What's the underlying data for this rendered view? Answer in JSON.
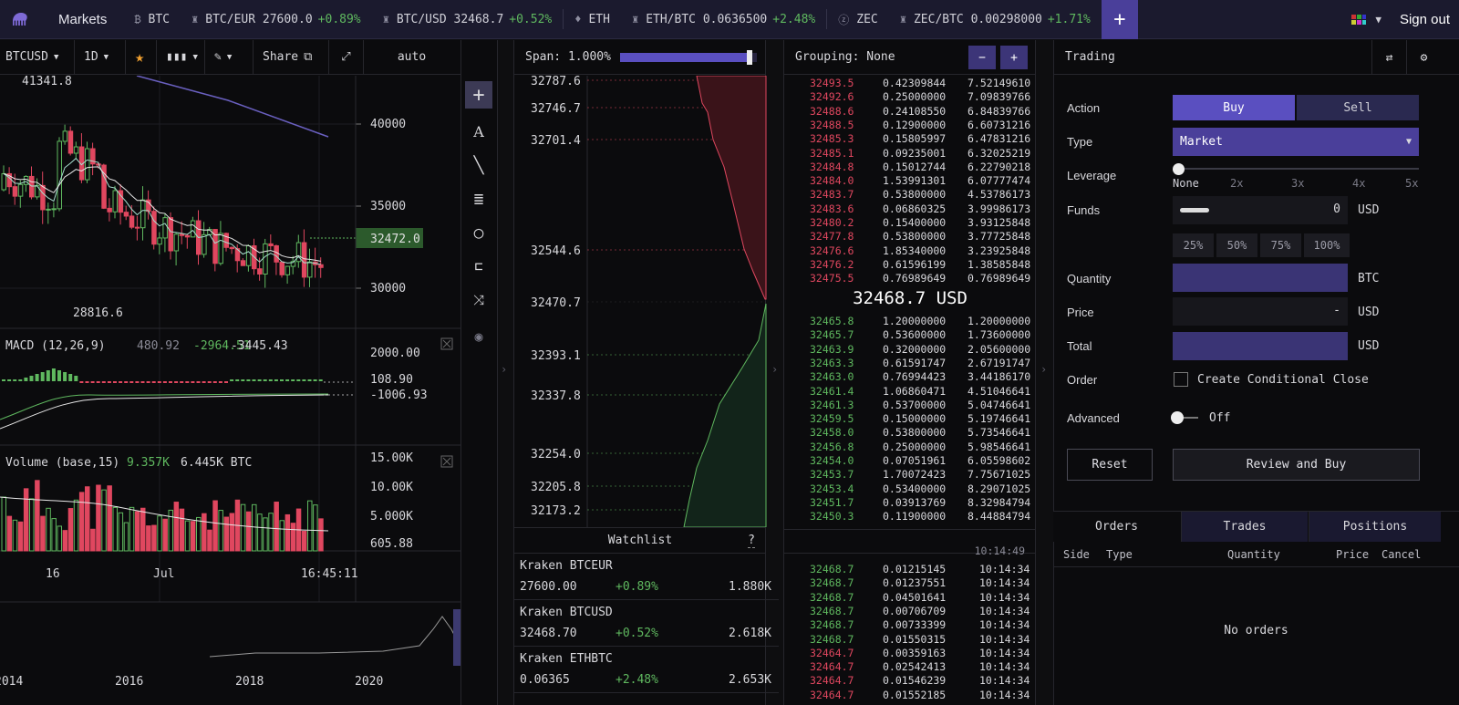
{
  "topbar": {
    "markets": "Markets",
    "tickers": [
      {
        "icon": "bitcoin-icon",
        "glyph": "₿",
        "label": "BTC",
        "change": ""
      },
      {
        "icon": "kraken-icon",
        "glyph": "♜",
        "label": "BTC/EUR 27600.0",
        "change": "+0.89%"
      },
      {
        "icon": "kraken-icon",
        "glyph": "♜",
        "label": "BTC/USD 32468.7",
        "change": "+0.52%"
      },
      {
        "icon": "ethereum-icon",
        "glyph": "♦",
        "label": "ETH",
        "change": ""
      },
      {
        "icon": "kraken-icon",
        "glyph": "♜",
        "label": "ETH/BTC 0.0636500",
        "change": "+2.48%"
      },
      {
        "icon": "zcash-icon",
        "glyph": "ⓩ",
        "label": "ZEC",
        "change": ""
      },
      {
        "icon": "kraken-icon",
        "glyph": "♜",
        "label": "ZEC/BTC 0.00298000",
        "change": "+1.71%"
      }
    ],
    "add": "+",
    "sign_out": "Sign out"
  },
  "chart_toolbar": {
    "symbol": "BTCUSD",
    "interval": "1D",
    "share": "Share",
    "auto": "auto"
  },
  "chart_data": [
    {
      "type": "candlestick",
      "price_labels": {
        "high": "41341.8",
        "low": "28816.6",
        "current": "32472.0"
      },
      "y_ticks": [
        "40000",
        "35000",
        "30000"
      ],
      "ylim": [
        28000,
        43000
      ]
    },
    {
      "type": "bar",
      "title": "MACD (12,26,9)",
      "values_text": [
        "480.92",
        "-2964.51",
        "-3445.43"
      ],
      "y_ticks": [
        "2000.00",
        "108.90",
        "-1006.93"
      ]
    },
    {
      "type": "bar",
      "title": "Volume (base,15)",
      "values_text": [
        "9.357K",
        "6.445K BTC"
      ],
      "y_ticks": [
        "15.00K",
        "10.00K",
        "5.000K",
        "605.88"
      ]
    }
  ],
  "chart_axis": {
    "x_ticks": [
      "16",
      "Jul",
      "16:45:11"
    ],
    "nav_years": [
      "2014",
      "2016",
      "2018",
      "2020"
    ]
  },
  "depth": {
    "span": "Span: 1.000%",
    "span_value": 0.95,
    "labels": [
      "32787.6",
      "32746.7",
      "32701.4",
      "32544.6",
      "32470.7",
      "32393.1",
      "32337.8",
      "32254.0",
      "32205.8",
      "32173.2"
    ]
  },
  "watchlist": {
    "title": "Watchlist",
    "help": "?",
    "items": [
      {
        "name": "Kraken BTCEUR",
        "price": "27600.00",
        "change": "+0.89%",
        "volume": "1.880K"
      },
      {
        "name": "Kraken BTCUSD",
        "price": "32468.70",
        "change": "+0.52%",
        "volume": "2.618K"
      },
      {
        "name": "Kraken ETHBTC",
        "price": "0.06365",
        "change": "+2.48%",
        "volume": "2.653K"
      }
    ]
  },
  "orderbook": {
    "grouping": "Grouping: None",
    "minus": "−",
    "plus": "+",
    "asks": [
      [
        "32493.5",
        "0.42309844",
        "7.52149610"
      ],
      [
        "32492.6",
        "0.25000000",
        "7.09839766"
      ],
      [
        "32488.6",
        "0.24108550",
        "6.84839766"
      ],
      [
        "32488.5",
        "0.12900000",
        "6.60731216"
      ],
      [
        "32485.3",
        "0.15805997",
        "6.47831216"
      ],
      [
        "32485.1",
        "0.09235001",
        "6.32025219"
      ],
      [
        "32484.8",
        "0.15012744",
        "6.22790218"
      ],
      [
        "32484.0",
        "1.53991301",
        "6.07777474"
      ],
      [
        "32483.7",
        "0.53800000",
        "4.53786173"
      ],
      [
        "32483.6",
        "0.06860325",
        "3.99986173"
      ],
      [
        "32480.2",
        "0.15400000",
        "3.93125848"
      ],
      [
        "32477.8",
        "0.53800000",
        "3.77725848"
      ],
      [
        "32476.6",
        "1.85340000",
        "3.23925848"
      ],
      [
        "32476.2",
        "0.61596199",
        "1.38585848"
      ],
      [
        "32475.5",
        "0.76989649",
        "0.76989649"
      ]
    ],
    "mid": "32468.7 USD",
    "bids": [
      [
        "32465.8",
        "1.20000000",
        "1.20000000"
      ],
      [
        "32465.7",
        "0.53600000",
        "1.73600000"
      ],
      [
        "32463.9",
        "0.32000000",
        "2.05600000"
      ],
      [
        "32463.3",
        "0.61591747",
        "2.67191747"
      ],
      [
        "32463.0",
        "0.76994423",
        "3.44186170"
      ],
      [
        "32461.4",
        "1.06860471",
        "4.51046641"
      ],
      [
        "32461.3",
        "0.53700000",
        "5.04746641"
      ],
      [
        "32459.5",
        "0.15000000",
        "5.19746641"
      ],
      [
        "32458.0",
        "0.53800000",
        "5.73546641"
      ],
      [
        "32456.8",
        "0.25000000",
        "5.98546641"
      ],
      [
        "32454.0",
        "0.07051961",
        "6.05598602"
      ],
      [
        "32453.7",
        "1.70072423",
        "7.75671025"
      ],
      [
        "32453.4",
        "0.53400000",
        "8.29071025"
      ],
      [
        "32451.7",
        "0.03913769",
        "8.32984794"
      ],
      [
        "32450.3",
        "0.11900000",
        "8.44884794"
      ]
    ],
    "time": "10:14:49",
    "trades": [
      [
        "32468.7",
        "0.01215145",
        "10:14:34",
        "g"
      ],
      [
        "32468.7",
        "0.01237551",
        "10:14:34",
        "g"
      ],
      [
        "32468.7",
        "0.04501641",
        "10:14:34",
        "g"
      ],
      [
        "32468.7",
        "0.00706709",
        "10:14:34",
        "g"
      ],
      [
        "32468.7",
        "0.00733399",
        "10:14:34",
        "g"
      ],
      [
        "32468.7",
        "0.01550315",
        "10:14:34",
        "g"
      ],
      [
        "32464.7",
        "0.00359163",
        "10:14:34",
        "r"
      ],
      [
        "32464.7",
        "0.02542413",
        "10:14:34",
        "r"
      ],
      [
        "32464.7",
        "0.01546239",
        "10:14:34",
        "r"
      ],
      [
        "32464.7",
        "0.01552185",
        "10:14:34",
        "r"
      ]
    ]
  },
  "trading": {
    "title": "Trading",
    "action_label": "Action",
    "buy": "Buy",
    "sell": "Sell",
    "type_label": "Type",
    "type_value": "Market",
    "leverage_label": "Leverage",
    "leverage_ticks": [
      "None",
      "2x",
      "3x",
      "4x",
      "5x"
    ],
    "funds_label": "Funds",
    "funds_value": "0",
    "funds_unit": "USD",
    "pcts": [
      "25%",
      "50%",
      "75%",
      "100%"
    ],
    "quantity_label": "Quantity",
    "quantity_unit": "BTC",
    "price_label": "Price",
    "price_value": "-",
    "price_unit": "USD",
    "total_label": "Total",
    "total_unit": "USD",
    "order_label": "Order",
    "conditional": "Create Conditional Close",
    "advanced_label": "Advanced",
    "advanced_value": "Off",
    "reset": "Reset",
    "review": "Review and Buy"
  },
  "orders": {
    "tabs": [
      "Orders",
      "Trades",
      "Positions"
    ],
    "columns": [
      "Side",
      "Type",
      "Quantity",
      "Price",
      "Cancel"
    ],
    "empty": "No orders"
  },
  "colors": {
    "accent": "#4a3f9a",
    "buy": "#5fb85f",
    "sell": "#e0475f"
  }
}
